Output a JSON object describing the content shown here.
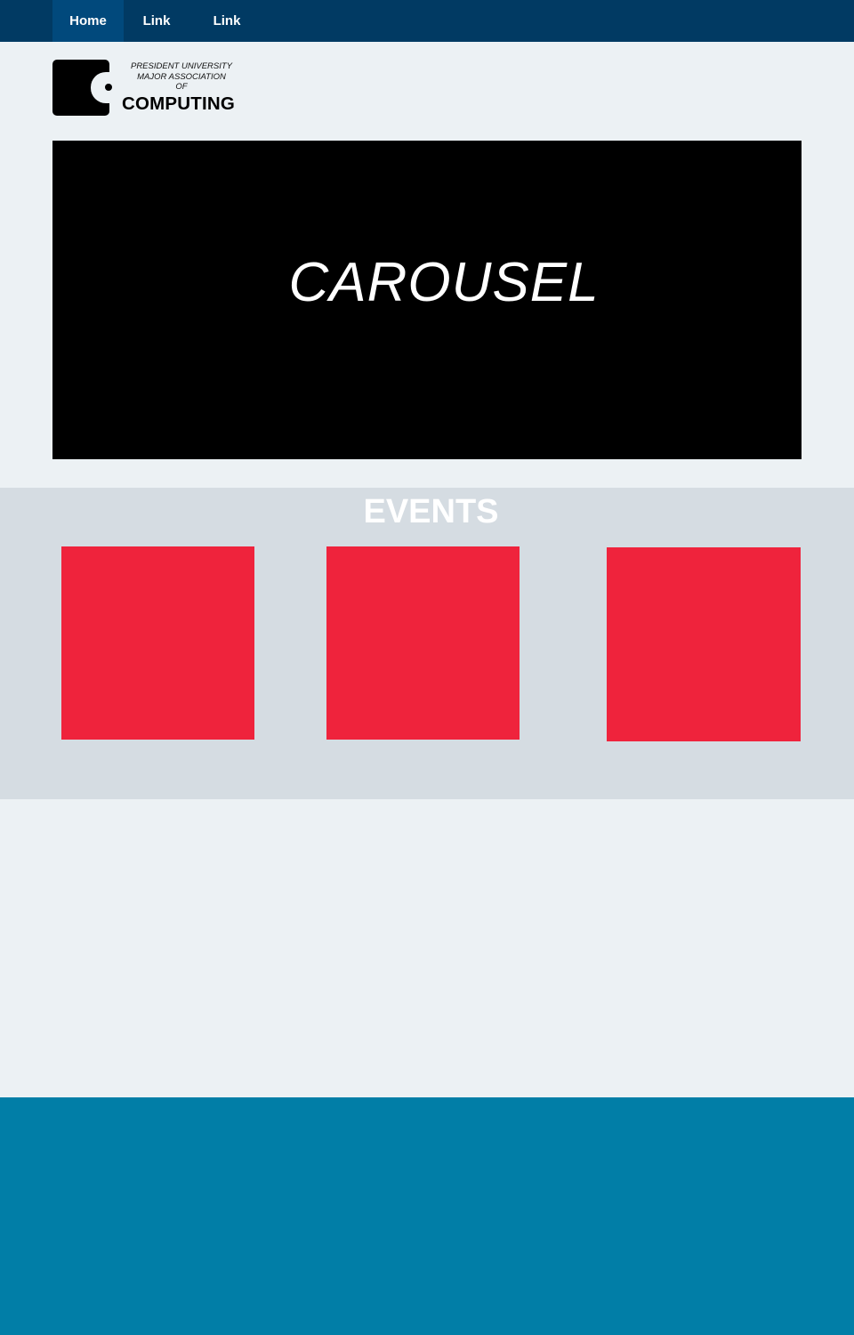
{
  "nav": {
    "items": [
      {
        "label": "Home",
        "active": true
      },
      {
        "label": "Link",
        "active": false
      },
      {
        "label": "Link",
        "active": false
      }
    ]
  },
  "logo": {
    "line1": "PRESIDENT UNIVERSITY",
    "line2": "MAJOR ASSOCIATION",
    "line3": "OF",
    "line4": "COMPUTING"
  },
  "carousel": {
    "label": "CAROUSEL"
  },
  "events": {
    "title": "EVENTS",
    "card_color": "#ef233c",
    "cards": [
      {},
      {},
      {}
    ]
  },
  "colors": {
    "nav_bg": "#013a63",
    "nav_active": "#01497c",
    "page_bg": "#ecf1f4",
    "events_bg": "#d5dce2",
    "footer_bg": "#017ea7"
  }
}
